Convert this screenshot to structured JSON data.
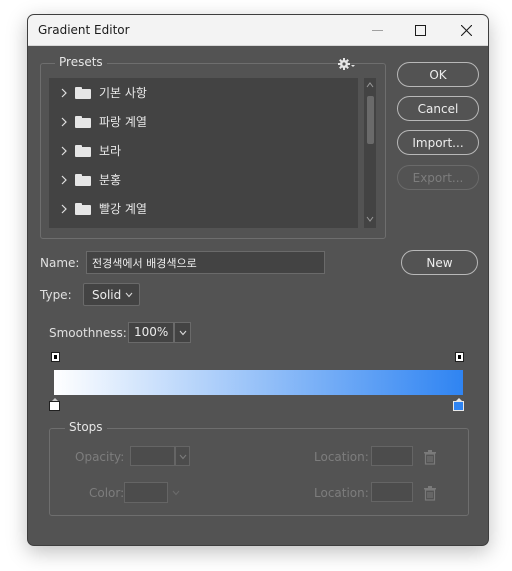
{
  "window": {
    "title": "Gradient Editor",
    "controls": {
      "minimize": "minimize-icon",
      "maximize": "maximize-icon",
      "close": "close-icon"
    }
  },
  "presets": {
    "title": "Presets",
    "settings_icon": "gear-icon",
    "items": [
      {
        "label": "기본 사항"
      },
      {
        "label": "파랑 계열"
      },
      {
        "label": "보라"
      },
      {
        "label": "분홍"
      },
      {
        "label": "빨강 계열"
      }
    ]
  },
  "buttons": {
    "ok": "OK",
    "cancel": "Cancel",
    "import": "Import...",
    "export": "Export...",
    "new": "New"
  },
  "name": {
    "label": "Name:",
    "value": "전경색에서 배경색으로"
  },
  "type": {
    "label": "Type:",
    "value": "Solid"
  },
  "smoothness": {
    "label": "Smoothness:",
    "value": "100%"
  },
  "gradient": {
    "start_color": "#ffffff",
    "end_color": "#2f84f2"
  },
  "stops": {
    "title": "Stops",
    "opacity_label": "Opacity:",
    "color_label": "Color:",
    "location_label_1": "Location:",
    "location_label_2": "Location:"
  },
  "colors": {
    "dialog_bg": "#535353",
    "list_bg": "#434343",
    "text": "#e0e0e0",
    "disabled_text": "#7d7d7d",
    "accent": "#2f84f2"
  }
}
